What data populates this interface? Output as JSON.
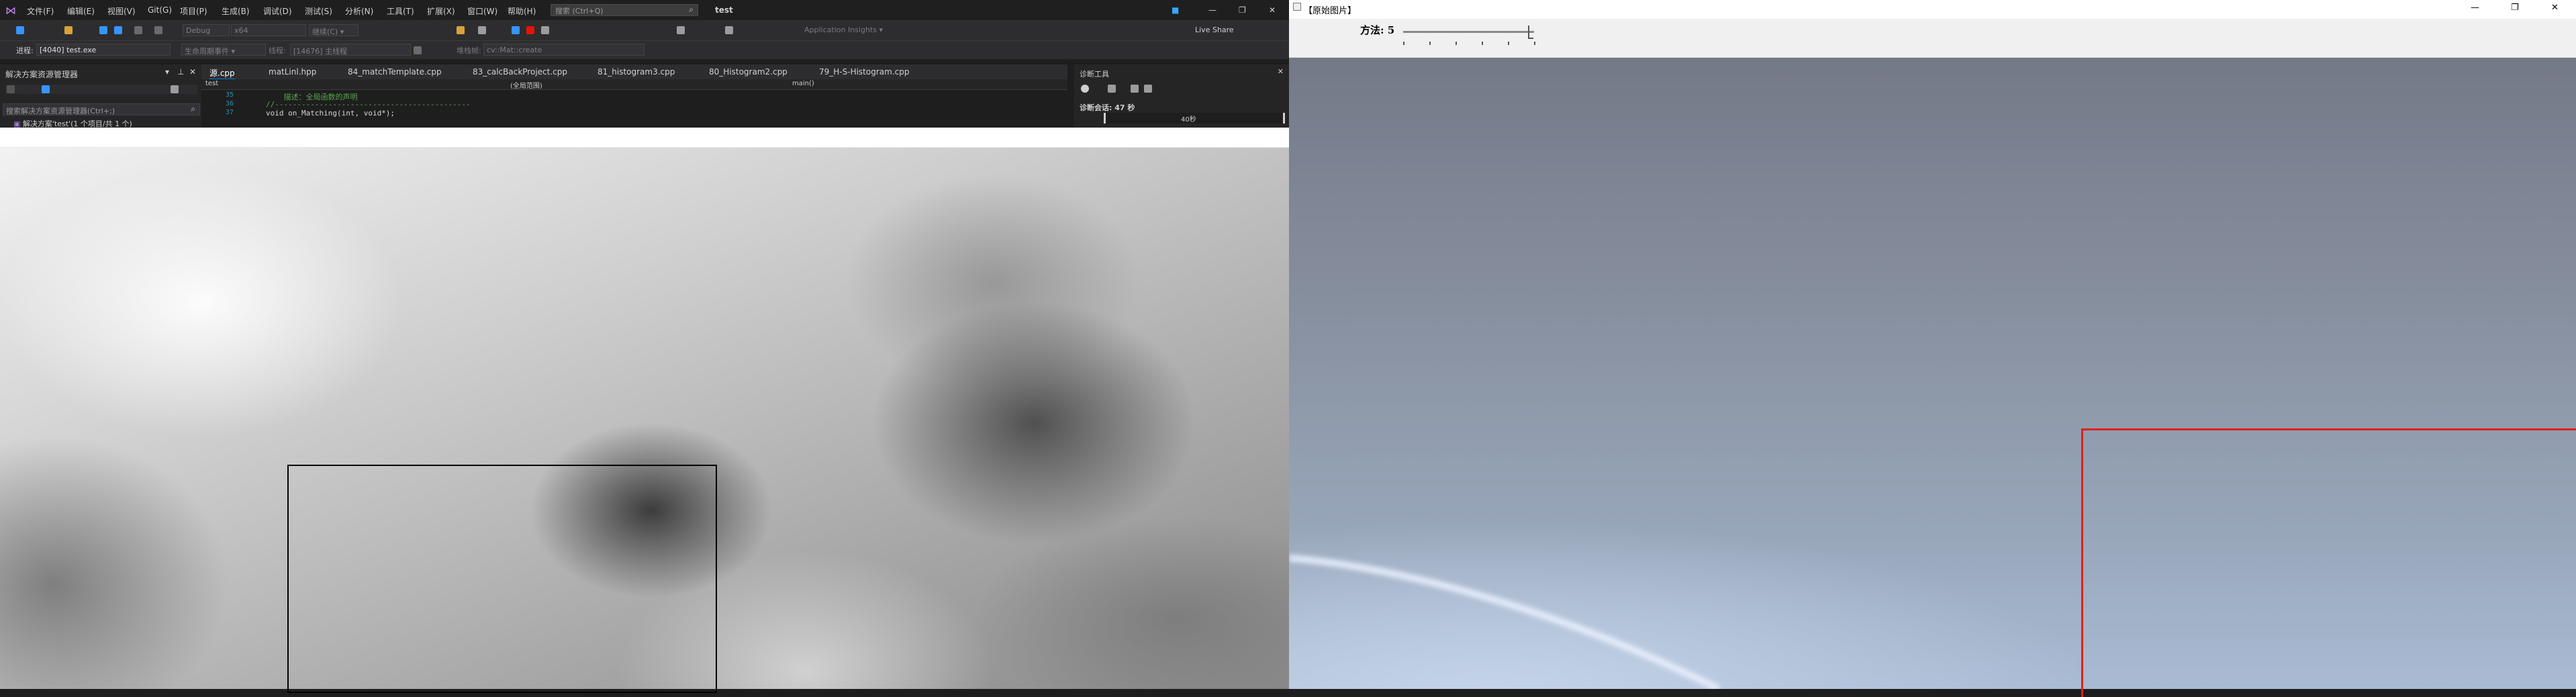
{
  "vs": {
    "menu": [
      "文件(F)",
      "编辑(E)",
      "视图(V)",
      "Git(G)",
      "项目(P)",
      "生成(B)",
      "调试(D)",
      "测试(S)",
      "分析(N)",
      "工具(T)",
      "扩展(X)",
      "窗口(W)",
      "帮助(H)"
    ],
    "search_placeholder": "搜索 (Ctrl+Q)",
    "solution_title": "test",
    "toolbar": {
      "config": "Debug",
      "platform": "x64",
      "continue_label": "继续(C) ▾",
      "app_insights": "Application Insights ▾",
      "live_share": "Live Share"
    },
    "process_label": "进程:",
    "process_value": "[4040] test.exe",
    "lifecycle": "生命周期事件 ▾",
    "thread_label": "线程:",
    "thread_value": "[14676] 主线程",
    "stack_value": "cv::Mat::create",
    "solution_explorer": {
      "title": "解决方案资源管理器",
      "search_placeholder": "搜索解决方案资源管理器(Ctrl+;)",
      "root": "解决方案'test'(1 个项目/共 1 个)"
    },
    "tabs": [
      "源.cpp",
      "matLinl.hpp",
      "84_matchTemplate.cpp",
      "83_calcBackProject.cpp",
      "81_histogram3.cpp",
      "80_Histogram2.cpp",
      "79_H-S-Histogram.cpp"
    ],
    "nav": {
      "project": "test",
      "scope": "(全局范围)",
      "func": "main()"
    },
    "code": [
      {
        "num": "35",
        "text": "    描述：全局函数的声明"
      },
      {
        "num": "36",
        "text": "//--------------------------------------------"
      },
      {
        "num": "37",
        "text": "void on_Matching(int, void*);"
      }
    ],
    "diag": {
      "title": "诊断工具",
      "session": "诊断会话: 47 秒",
      "timeline": "40秒"
    }
  },
  "image_window": {
    "title": "【原始图片】",
    "trackbar_label": "方法: 5",
    "trackbar_value": 5,
    "trackbar_max": 5,
    "colors": {
      "rect_left": "#000000",
      "rect_right": "#e0201a"
    }
  }
}
